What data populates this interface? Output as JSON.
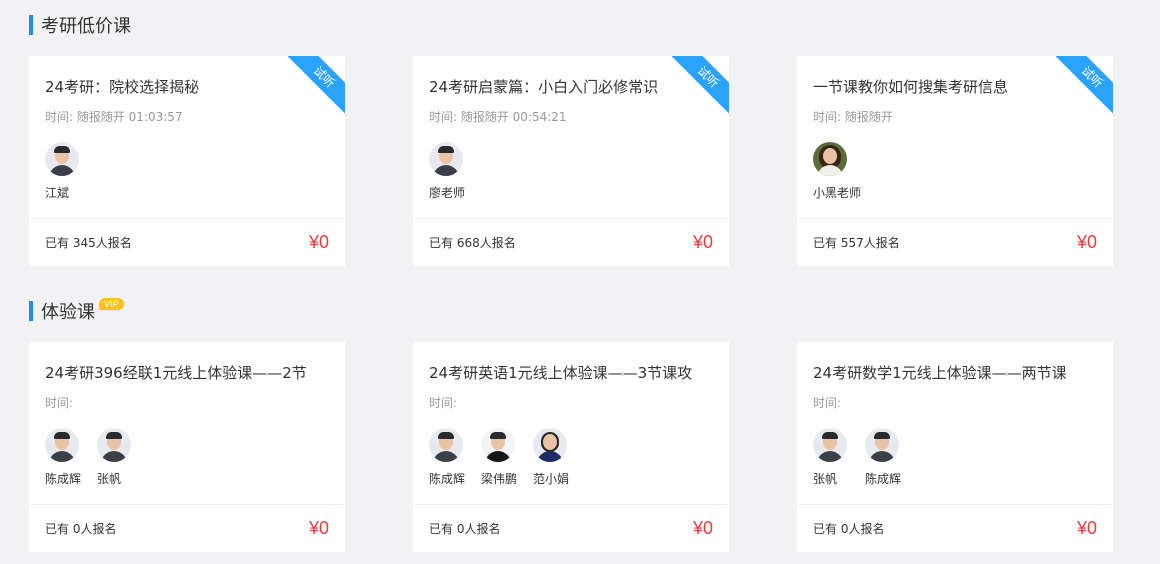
{
  "sections": [
    {
      "title": "考研低价课",
      "cards": [
        {
          "title": "24考研：院校选择揭秘",
          "time": "时间:   随报随开 01:03:57",
          "badge": "试听",
          "teachers": [
            {
              "name": "江斌"
            }
          ],
          "enroll": "已有 345人报名",
          "price": "¥0"
        },
        {
          "title": "24考研启蒙篇：小白入门必修常识",
          "time": "时间:   随报随开 00:54:21",
          "badge": "试听",
          "teachers": [
            {
              "name": "廖老师"
            }
          ],
          "enroll": "已有 668人报名",
          "price": "¥0"
        },
        {
          "title": "一节课教你如何搜集考研信息",
          "time": "时间:   随报随开",
          "badge": "试听",
          "teachers": [
            {
              "name": "小黑老师"
            }
          ],
          "enroll": "已有 557人报名",
          "price": "¥0"
        }
      ]
    },
    {
      "title": "体验课",
      "badge": "VIP",
      "cards": [
        {
          "title": "24考研396经联1元线上体验课——2节",
          "time": "时间:",
          "teachers": [
            {
              "name": "陈成辉"
            },
            {
              "name": "张帆"
            }
          ],
          "enroll": "已有 0人报名",
          "price": "¥0"
        },
        {
          "title": "24考研英语1元线上体验课——3节课攻",
          "time": "时间:",
          "teachers": [
            {
              "name": "陈成辉"
            },
            {
              "name": "梁伟鹏"
            },
            {
              "name": "范小娟"
            }
          ],
          "enroll": "已有 0人报名",
          "price": "¥0"
        },
        {
          "title": "24考研数学1元线上体验课——两节课",
          "time": "时间:",
          "teachers": [
            {
              "name": "张帆"
            },
            {
              "name": "陈成辉"
            }
          ],
          "enroll": "已有 0人报名",
          "price": "¥0"
        }
      ]
    }
  ],
  "colors": {
    "accent": "#1e8cff",
    "ribbon": "#29a3ff",
    "price": "#f23b3b",
    "vip": "#ffc21a"
  }
}
